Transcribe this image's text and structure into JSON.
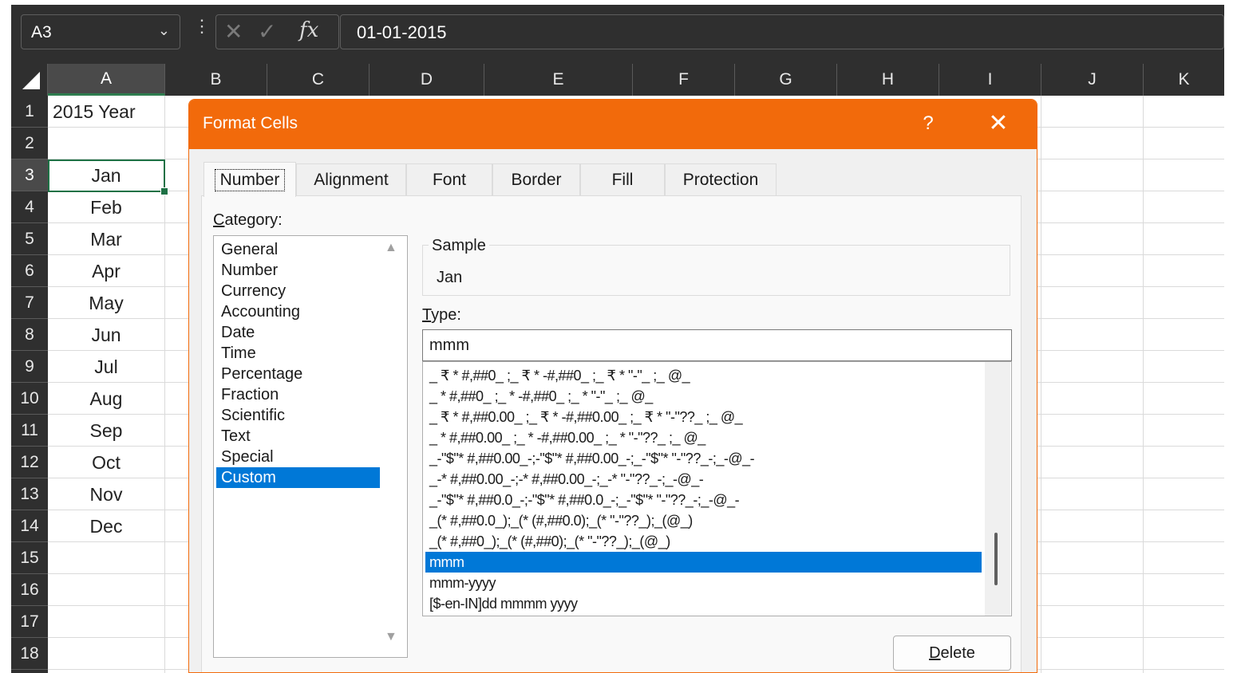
{
  "formula_bar": {
    "name_box": "A3",
    "name_box_chevron": "chevron-down-icon",
    "dots": "⋮",
    "cancel_symbol": "✕",
    "enter_symbol": "✓",
    "fx_symbol": "fx",
    "formula": "01-01-2015"
  },
  "columns": [
    "A",
    "B",
    "C",
    "D",
    "E",
    "F",
    "G",
    "H",
    "I",
    "J",
    "K"
  ],
  "rows": [
    "1",
    "2",
    "3",
    "4",
    "5",
    "6",
    "7",
    "8",
    "9",
    "10",
    "11",
    "12",
    "13",
    "14",
    "15",
    "16",
    "17",
    "18"
  ],
  "cells": {
    "A1": "2015 Year",
    "A3": "Jan",
    "A4": "Feb",
    "A5": "Mar",
    "A6": "Apr",
    "A7": "May",
    "A8": "Jun",
    "A9": "Jul",
    "A10": "Aug",
    "A11": "Sep",
    "A12": "Oct",
    "A13": "Nov",
    "A14": "Dec"
  },
  "dialog": {
    "title": "Format Cells",
    "help_label": "?",
    "close_label": "✕",
    "accent_color": "#f26a0b",
    "tabs": [
      "Number",
      "Alignment",
      "Font",
      "Border",
      "Fill",
      "Protection"
    ],
    "active_tab": "Number",
    "category_label_first": "C",
    "category_label_rest": "ategory:",
    "categories": [
      "General",
      "Number",
      "Currency",
      "Accounting",
      "Date",
      "Time",
      "Percentage",
      "Fraction",
      "Scientific",
      "Text",
      "Special",
      "Custom"
    ],
    "selected_category": "Custom",
    "sample_label": "Sample",
    "sample_value": "Jan",
    "type_label_first": "T",
    "type_label_rest": "ype:",
    "type_value": "mmm",
    "type_list": [
      "_ ₹ * #,##0_ ;_ ₹ * -#,##0_ ;_ ₹ * \"-\"_ ;_ @_",
      "_ * #,##0_ ;_ * -#,##0_ ;_ * \"-\"_ ;_ @_",
      "_ ₹ * #,##0.00_ ;_ ₹ * -#,##0.00_ ;_ ₹ * \"-\"??_ ;_ @_",
      "_ * #,##0.00_ ;_ * -#,##0.00_ ;_ * \"-\"??_ ;_ @_",
      "_-\"$\"* #,##0.00_-;-\"$\"* #,##0.00_-;_-\"$\"* \"-\"??_-;_-@_-",
      "_-* #,##0.00_-;-* #,##0.00_-;_-* \"-\"??_-;_-@_-",
      "_-\"$\"* #,##0.0_-;-\"$\"* #,##0.0_-;_-\"$\"* \"-\"??_-;_-@_-",
      "_(* #,##0.0_);_(* (#,##0.0);_(* \"-\"??_);_(@_)",
      "_(* #,##0_);_(* (#,##0);_(* \"-\"??_);_(@_)",
      "mmm",
      "mmm-yyyy",
      "[$-en-IN]dd mmmm yyyy"
    ],
    "selected_type": "mmm",
    "delete_first": "D",
    "delete_rest": "elete"
  }
}
